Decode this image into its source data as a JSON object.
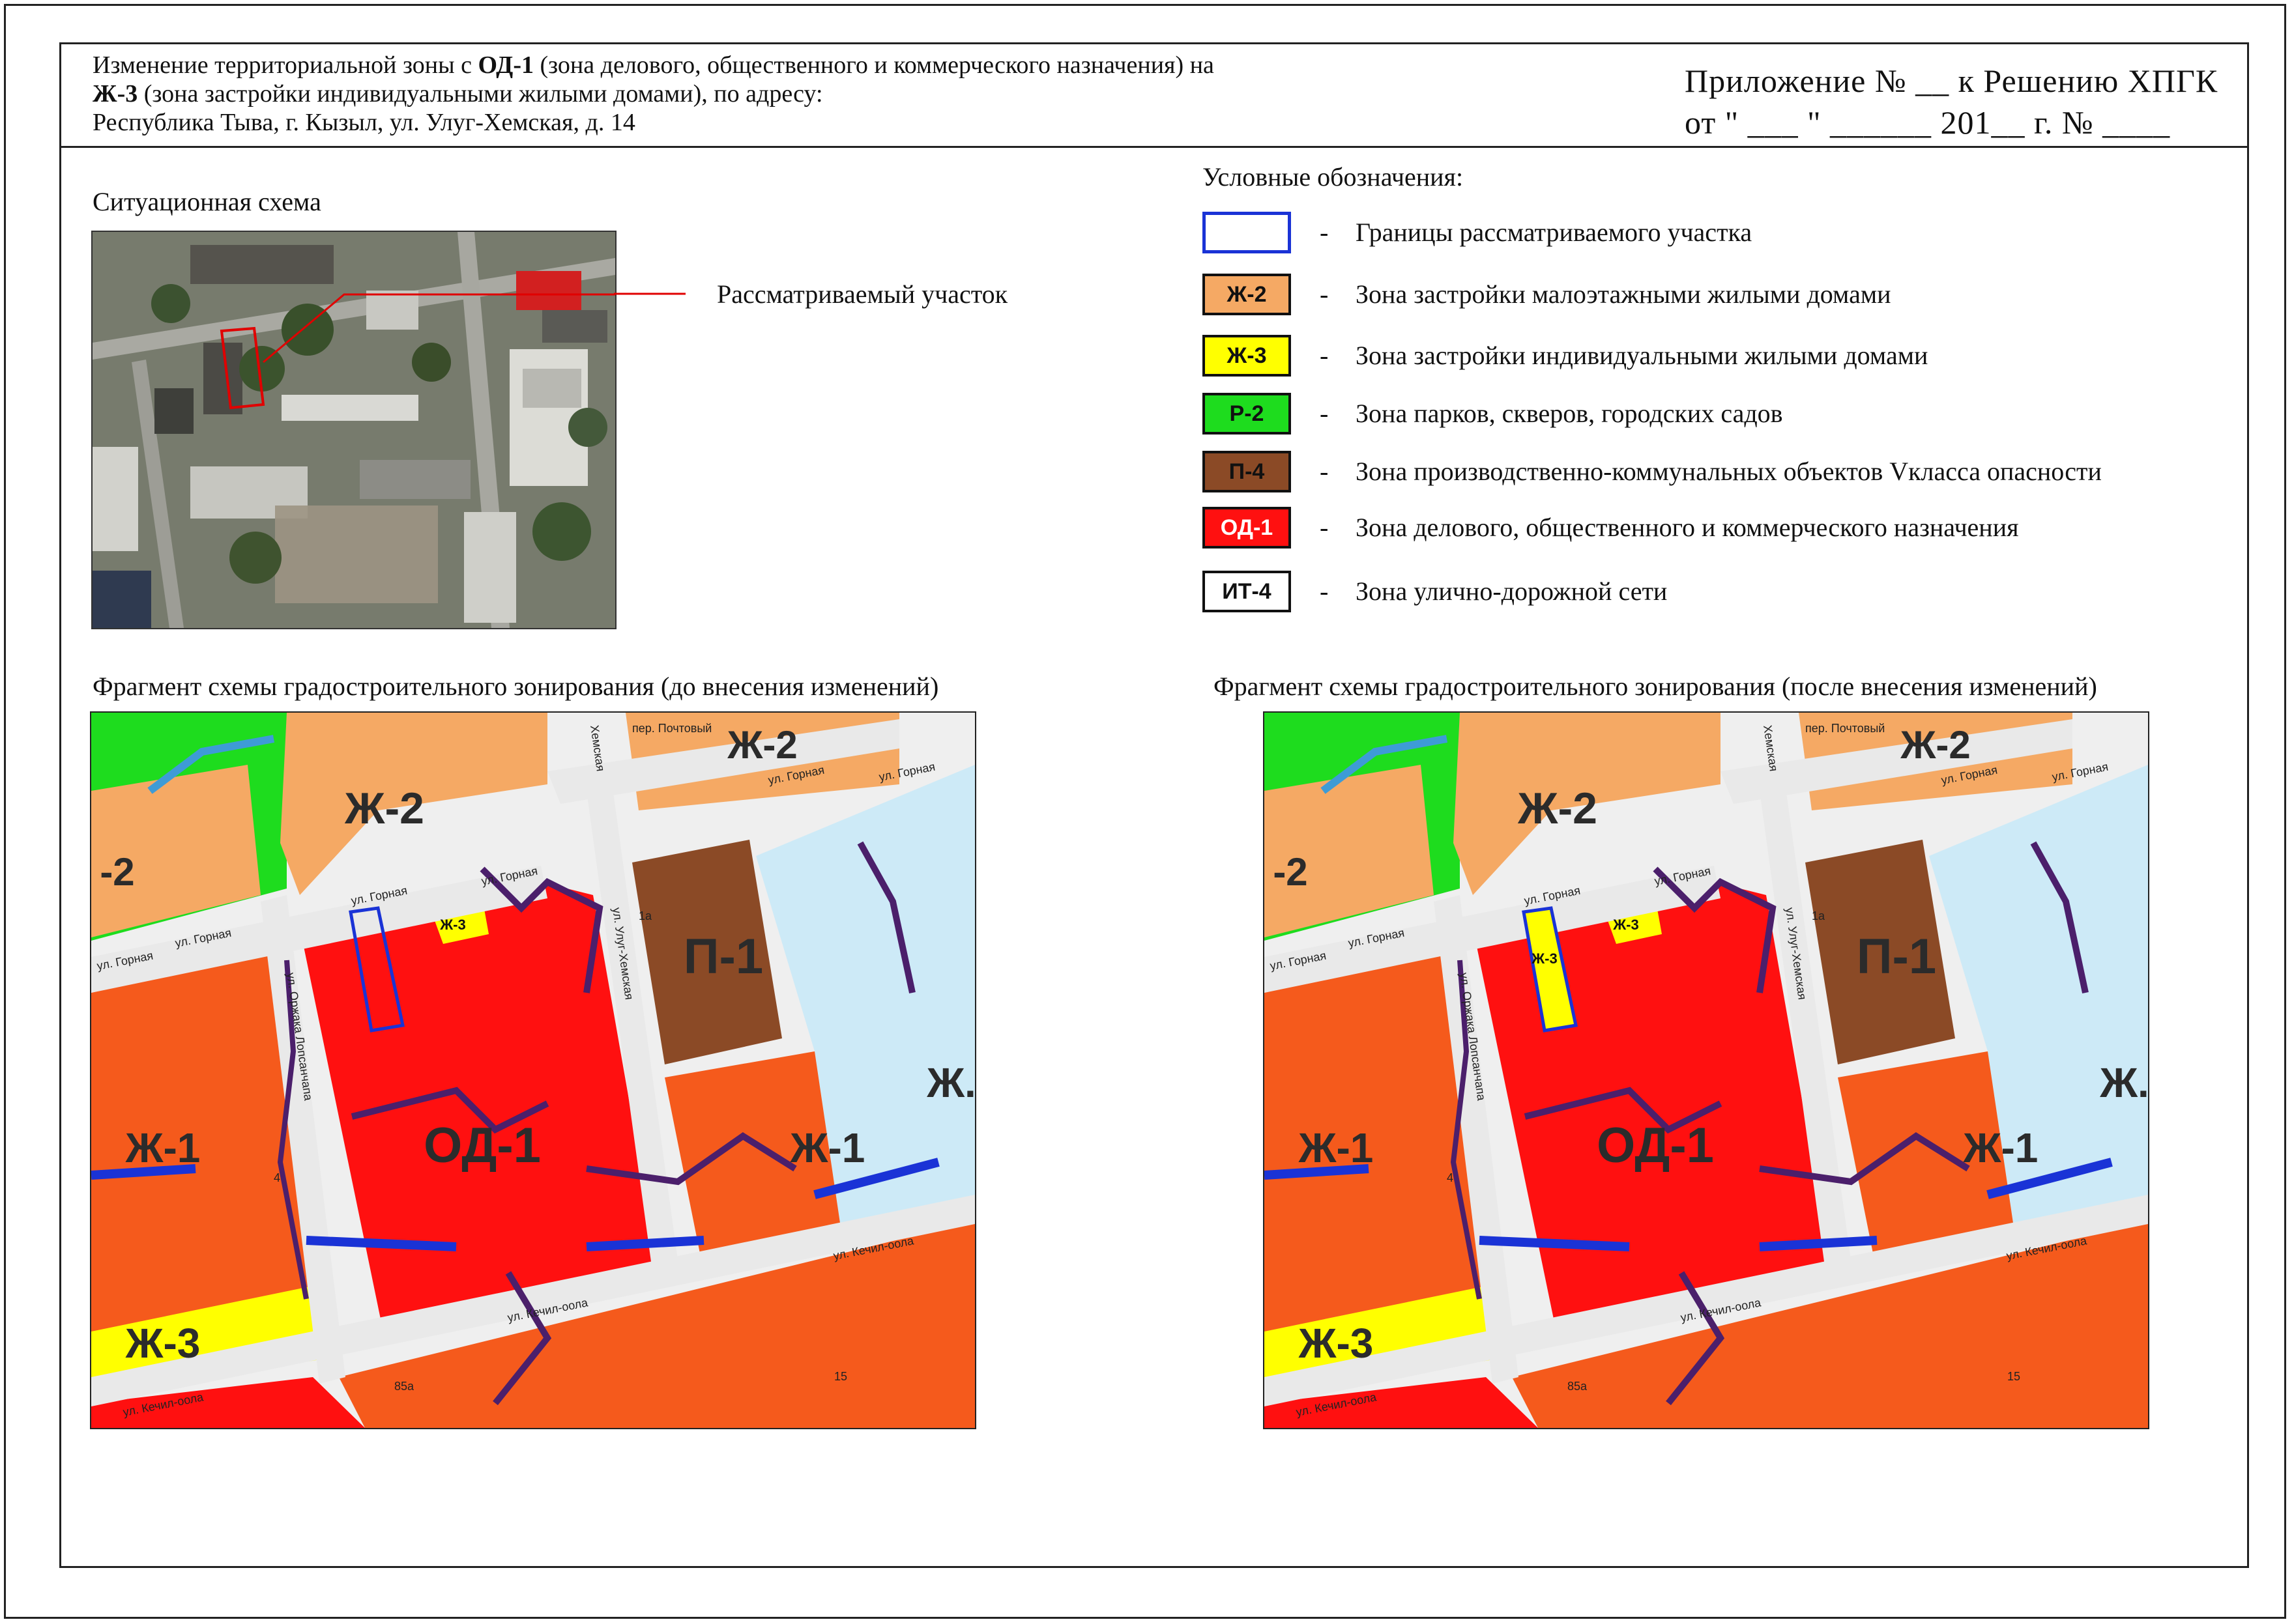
{
  "header": {
    "line1_pre": "Изменение территориальной зоны с ",
    "line1_bold": "ОД-1",
    "line1_post": " (зона делового, общественного и коммерческого назначения) на",
    "line2_bold": "Ж-3",
    "line2_post": " (зона застройки индивидуальными жилыми домами), по адресу:",
    "line3": "Республика Тыва, г. Кызыл, ул. Улуг-Хемская, д. 14",
    "appendix_line1": "Приложение № __  к Решению ХПГК",
    "appendix_line2": "от \" ___ \"  ______   201__ г. № ____"
  },
  "situational": {
    "title": "Ситуационная схема",
    "callout": "Рассматриваемый участок"
  },
  "legend": {
    "title": "Условные обозначения:",
    "items": [
      {
        "code": "",
        "text": "Границы рассматриваемого участка",
        "color": "#ffffff",
        "border": "#1a33d6"
      },
      {
        "code": "Ж-2",
        "text": "Зона застройки малоэтажными жилыми домами",
        "color": "#f5a964",
        "border": "#111111"
      },
      {
        "code": "Ж-3",
        "text": "Зона застройки индивидуальными жилыми домами",
        "color": "#ffff00",
        "border": "#111111"
      },
      {
        "code": "Р-2",
        "text": "Зона парков, скверов, городских садов",
        "color": "#1edc1e",
        "border": "#111111"
      },
      {
        "code": "П-4",
        "text": "Зона производственно-коммунальных объектов Vкласса опасности",
        "color": "#8b4a26",
        "border": "#111111"
      },
      {
        "code": "ОД-1",
        "text": "Зона делового, общественного и коммерческого назначения",
        "color": "#ff1010",
        "border": "#111111"
      },
      {
        "code": "ИТ-4",
        "text": "Зона улично-дорожной сети",
        "color": "#ffffff",
        "border": "#111111"
      }
    ]
  },
  "maps": {
    "before_title": "Фрагмент схемы градостроительного зонирования (до внесения изменений)",
    "after_title": "Фрагмент схемы градостроительного зонирования (после внесения изменений)",
    "zone_labels": {
      "zh2_big": "Ж-2",
      "zh2_top": "Ж-2",
      "zh2_left": "-2",
      "p1": "П-1",
      "zh_right": "Ж.",
      "od1": "ОД-1",
      "zh1_left": "Ж-1",
      "zh1_right": "Ж-1",
      "zh3_bottom": "Ж-3",
      "zh3_small": "Ж-3"
    },
    "street_labels": {
      "pochtovy": "пер. Почтовый",
      "gornaya": "ул. Горная",
      "ulug": "ул. Улуг-Хемская",
      "khemskaya_top": "Хемская",
      "orzhak": "ул. Оржака Лопсанчапа",
      "kechil": "ул. Кечил-оола"
    },
    "house_numbers": [
      "1а",
      "4",
      "85а",
      "15"
    ]
  }
}
